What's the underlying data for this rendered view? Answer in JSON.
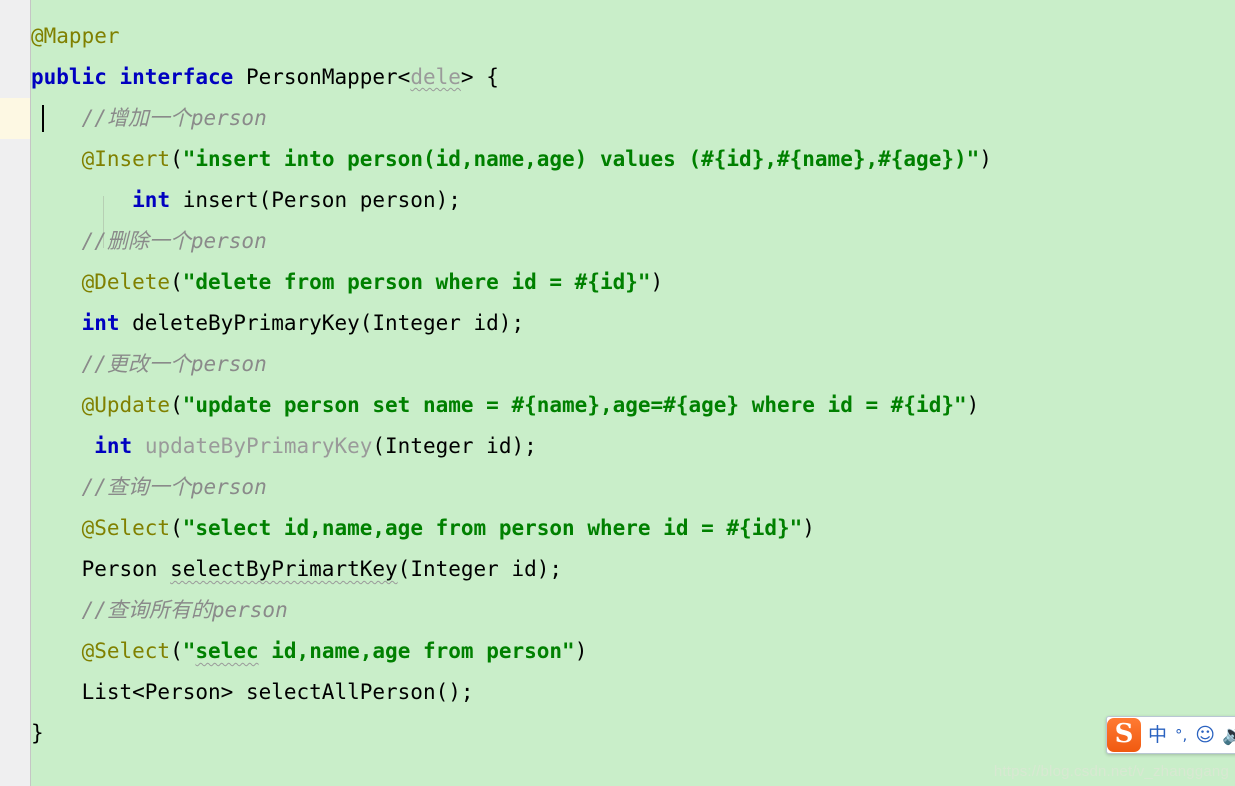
{
  "editor": {
    "background_color": "#c9eec9",
    "current_line_color": "#fdf8e8",
    "gutter_color": "#efeff0",
    "colors": {
      "keyword": "#0000c0",
      "annotation": "#808000",
      "string": "#008000",
      "comment": "#8a8a8a",
      "plain": "#000000",
      "dimmed": "#9a9a9a"
    },
    "caret": {
      "line_index": 2,
      "column": 5
    },
    "lines": [
      {
        "index": 0,
        "indent": 0,
        "tokens": [
          {
            "t": "@Mapper",
            "k": "anno"
          }
        ]
      },
      {
        "index": 1,
        "indent": 0,
        "tokens": [
          {
            "t": "public",
            "k": "kw"
          },
          {
            "t": " ",
            "k": "plain"
          },
          {
            "t": "interface",
            "k": "kw"
          },
          {
            "t": " PersonMapper<",
            "k": "plain"
          },
          {
            "t": "dele",
            "k": "err"
          },
          {
            "t": "> {",
            "k": "plain"
          }
        ]
      },
      {
        "index": 2,
        "indent": 1,
        "highlight": true,
        "tokens": [
          {
            "t": "//增加一个person",
            "k": "comment"
          }
        ]
      },
      {
        "index": 3,
        "indent": 1,
        "tokens": [
          {
            "t": "@Insert",
            "k": "anno"
          },
          {
            "t": "(",
            "k": "plain"
          },
          {
            "t": "\"insert into person(id,name,age) values (#{id},#{name},#{age})\"",
            "k": "str"
          },
          {
            "t": ")",
            "k": "plain"
          }
        ]
      },
      {
        "index": 4,
        "indent": 2,
        "tokens": [
          {
            "t": "int",
            "k": "kw"
          },
          {
            "t": " insert(Person person);",
            "k": "plain"
          }
        ]
      },
      {
        "index": 5,
        "indent": 1,
        "tokens": [
          {
            "t": "//删除一个person",
            "k": "comment"
          }
        ]
      },
      {
        "index": 6,
        "indent": 1,
        "tokens": [
          {
            "t": "@Delete",
            "k": "anno"
          },
          {
            "t": "(",
            "k": "plain"
          },
          {
            "t": "\"delete from person where id = #{id}\"",
            "k": "str"
          },
          {
            "t": ")",
            "k": "plain"
          }
        ]
      },
      {
        "index": 7,
        "indent": 1,
        "tokens": [
          {
            "t": "int",
            "k": "kw"
          },
          {
            "t": " deleteByPrimaryKey(Integer id);",
            "k": "plain"
          }
        ]
      },
      {
        "index": 8,
        "indent": 1,
        "tokens": [
          {
            "t": "//更改一个person",
            "k": "comment"
          }
        ]
      },
      {
        "index": 9,
        "indent": 1,
        "tokens": [
          {
            "t": "@Update",
            "k": "anno"
          },
          {
            "t": "(",
            "k": "plain"
          },
          {
            "t": "\"update person set name = #{name},age=#{age} where id = #{id}\"",
            "k": "str"
          },
          {
            "t": ")",
            "k": "plain"
          }
        ]
      },
      {
        "index": 10,
        "indent": 1,
        "tokens": [
          {
            "t": " int",
            "k": "kw"
          },
          {
            "t": " ",
            "k": "plain"
          },
          {
            "t": "updateByPrimaryKey",
            "k": "dim"
          },
          {
            "t": "(Integer id);",
            "k": "plain"
          }
        ]
      },
      {
        "index": 11,
        "indent": 1,
        "tokens": [
          {
            "t": "//查询一个person",
            "k": "comment"
          }
        ]
      },
      {
        "index": 12,
        "indent": 1,
        "tokens": [
          {
            "t": "@Select",
            "k": "anno"
          },
          {
            "t": "(",
            "k": "plain"
          },
          {
            "t": "\"select id,name,age from person where id = #{id}\"",
            "k": "str"
          },
          {
            "t": ")",
            "k": "plain"
          }
        ]
      },
      {
        "index": 13,
        "indent": 1,
        "tokens": [
          {
            "t": "Person ",
            "k": "plain"
          },
          {
            "t": "selectByPrimartKey",
            "k": "err-dark"
          },
          {
            "t": "(Integer id);",
            "k": "plain"
          }
        ]
      },
      {
        "index": 14,
        "indent": 1,
        "tokens": [
          {
            "t": "//查询所有的person",
            "k": "comment"
          }
        ]
      },
      {
        "index": 15,
        "indent": 1,
        "tokens": [
          {
            "t": "@Select",
            "k": "anno"
          },
          {
            "t": "(",
            "k": "plain"
          },
          {
            "t": "\"",
            "k": "str"
          },
          {
            "t": "selec",
            "k": "err-str"
          },
          {
            "t": " id,name,age from person\"",
            "k": "str"
          },
          {
            "t": ")",
            "k": "plain"
          }
        ]
      },
      {
        "index": 16,
        "indent": 1,
        "tokens": [
          {
            "t": "List<Person> selectAllPerson();",
            "k": "plain"
          }
        ]
      },
      {
        "index": 17,
        "indent": 0,
        "tokens": [
          {
            "t": "}",
            "k": "plain"
          }
        ]
      }
    ]
  },
  "watermark": {
    "text": "https://blog.csdn.net/v_zhanggang"
  },
  "ime_bar": {
    "logo": "S",
    "items": [
      {
        "name": "language-mode",
        "glyph": "中"
      },
      {
        "name": "punctuation-mode",
        "glyph": "°,"
      },
      {
        "name": "emoji",
        "glyph": "☺"
      },
      {
        "name": "voice-input",
        "glyph": "⬜"
      }
    ]
  }
}
